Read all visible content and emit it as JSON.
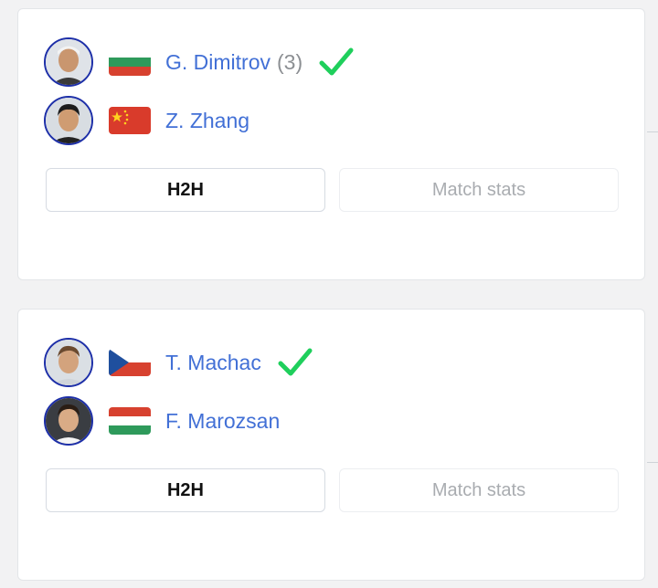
{
  "matches": [
    {
      "players": [
        {
          "name": "G. Dimitrov",
          "seed": "(3)",
          "country_flag": "bulgaria-flag",
          "winner": true
        },
        {
          "name": "Z. Zhang",
          "seed": "",
          "country_flag": "china-flag",
          "winner": false
        }
      ],
      "buttons": {
        "h2h": "H2H",
        "stats": "Match stats"
      }
    },
    {
      "players": [
        {
          "name": "T. Machac",
          "seed": "",
          "country_flag": "czech-republic-flag",
          "winner": true
        },
        {
          "name": "F. Marozsan",
          "seed": "",
          "country_flag": "hungary-flag",
          "winner": false
        }
      ],
      "buttons": {
        "h2h": "H2H",
        "stats": "Match stats"
      }
    }
  ],
  "colors": {
    "player_name": "#4270d6",
    "seed": "#8c8f93",
    "winner_check": "#1fcf5c",
    "avatar_border": "#1d2fa8",
    "background": "#f2f2f3"
  }
}
